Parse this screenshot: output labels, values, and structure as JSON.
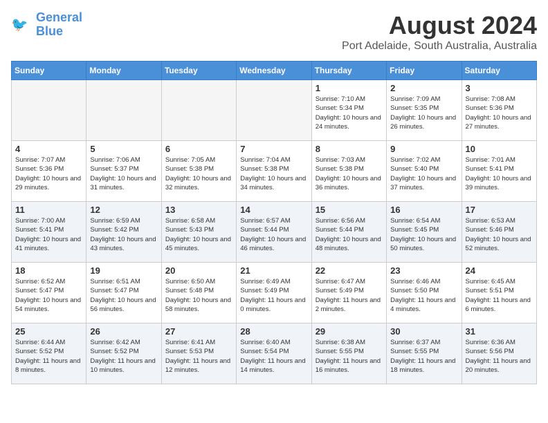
{
  "header": {
    "logo_line1": "General",
    "logo_line2": "Blue",
    "month_year": "August 2024",
    "location": "Port Adelaide, South Australia, Australia"
  },
  "days_of_week": [
    "Sunday",
    "Monday",
    "Tuesday",
    "Wednesday",
    "Thursday",
    "Friday",
    "Saturday"
  ],
  "weeks": [
    [
      {
        "day": "",
        "empty": true
      },
      {
        "day": "",
        "empty": true
      },
      {
        "day": "",
        "empty": true
      },
      {
        "day": "",
        "empty": true
      },
      {
        "day": "1",
        "sunrise": "7:10 AM",
        "sunset": "5:34 PM",
        "daylight": "10 hours and 24 minutes."
      },
      {
        "day": "2",
        "sunrise": "7:09 AM",
        "sunset": "5:35 PM",
        "daylight": "10 hours and 26 minutes."
      },
      {
        "day": "3",
        "sunrise": "7:08 AM",
        "sunset": "5:36 PM",
        "daylight": "10 hours and 27 minutes."
      }
    ],
    [
      {
        "day": "4",
        "sunrise": "7:07 AM",
        "sunset": "5:36 PM",
        "daylight": "10 hours and 29 minutes."
      },
      {
        "day": "5",
        "sunrise": "7:06 AM",
        "sunset": "5:37 PM",
        "daylight": "10 hours and 31 minutes."
      },
      {
        "day": "6",
        "sunrise": "7:05 AM",
        "sunset": "5:38 PM",
        "daylight": "10 hours and 32 minutes."
      },
      {
        "day": "7",
        "sunrise": "7:04 AM",
        "sunset": "5:38 PM",
        "daylight": "10 hours and 34 minutes."
      },
      {
        "day": "8",
        "sunrise": "7:03 AM",
        "sunset": "5:38 PM",
        "daylight": "10 hours and 36 minutes."
      },
      {
        "day": "9",
        "sunrise": "7:02 AM",
        "sunset": "5:40 PM",
        "daylight": "10 hours and 37 minutes."
      },
      {
        "day": "10",
        "sunrise": "7:01 AM",
        "sunset": "5:41 PM",
        "daylight": "10 hours and 39 minutes."
      }
    ],
    [
      {
        "day": "11",
        "sunrise": "7:00 AM",
        "sunset": "5:41 PM",
        "daylight": "10 hours and 41 minutes."
      },
      {
        "day": "12",
        "sunrise": "6:59 AM",
        "sunset": "5:42 PM",
        "daylight": "10 hours and 43 minutes."
      },
      {
        "day": "13",
        "sunrise": "6:58 AM",
        "sunset": "5:43 PM",
        "daylight": "10 hours and 45 minutes."
      },
      {
        "day": "14",
        "sunrise": "6:57 AM",
        "sunset": "5:44 PM",
        "daylight": "10 hours and 46 minutes."
      },
      {
        "day": "15",
        "sunrise": "6:56 AM",
        "sunset": "5:44 PM",
        "daylight": "10 hours and 48 minutes."
      },
      {
        "day": "16",
        "sunrise": "6:54 AM",
        "sunset": "5:45 PM",
        "daylight": "10 hours and 50 minutes."
      },
      {
        "day": "17",
        "sunrise": "6:53 AM",
        "sunset": "5:46 PM",
        "daylight": "10 hours and 52 minutes."
      }
    ],
    [
      {
        "day": "18",
        "sunrise": "6:52 AM",
        "sunset": "5:47 PM",
        "daylight": "10 hours and 54 minutes."
      },
      {
        "day": "19",
        "sunrise": "6:51 AM",
        "sunset": "5:47 PM",
        "daylight": "10 hours and 56 minutes."
      },
      {
        "day": "20",
        "sunrise": "6:50 AM",
        "sunset": "5:48 PM",
        "daylight": "10 hours and 58 minutes."
      },
      {
        "day": "21",
        "sunrise": "6:49 AM",
        "sunset": "5:49 PM",
        "daylight": "11 hours and 0 minutes."
      },
      {
        "day": "22",
        "sunrise": "6:47 AM",
        "sunset": "5:49 PM",
        "daylight": "11 hours and 2 minutes."
      },
      {
        "day": "23",
        "sunrise": "6:46 AM",
        "sunset": "5:50 PM",
        "daylight": "11 hours and 4 minutes."
      },
      {
        "day": "24",
        "sunrise": "6:45 AM",
        "sunset": "5:51 PM",
        "daylight": "11 hours and 6 minutes."
      }
    ],
    [
      {
        "day": "25",
        "sunrise": "6:44 AM",
        "sunset": "5:52 PM",
        "daylight": "11 hours and 8 minutes."
      },
      {
        "day": "26",
        "sunrise": "6:42 AM",
        "sunset": "5:52 PM",
        "daylight": "11 hours and 10 minutes."
      },
      {
        "day": "27",
        "sunrise": "6:41 AM",
        "sunset": "5:53 PM",
        "daylight": "11 hours and 12 minutes."
      },
      {
        "day": "28",
        "sunrise": "6:40 AM",
        "sunset": "5:54 PM",
        "daylight": "11 hours and 14 minutes."
      },
      {
        "day": "29",
        "sunrise": "6:38 AM",
        "sunset": "5:55 PM",
        "daylight": "11 hours and 16 minutes."
      },
      {
        "day": "30",
        "sunrise": "6:37 AM",
        "sunset": "5:55 PM",
        "daylight": "11 hours and 18 minutes."
      },
      {
        "day": "31",
        "sunrise": "6:36 AM",
        "sunset": "5:56 PM",
        "daylight": "11 hours and 20 minutes."
      }
    ]
  ]
}
